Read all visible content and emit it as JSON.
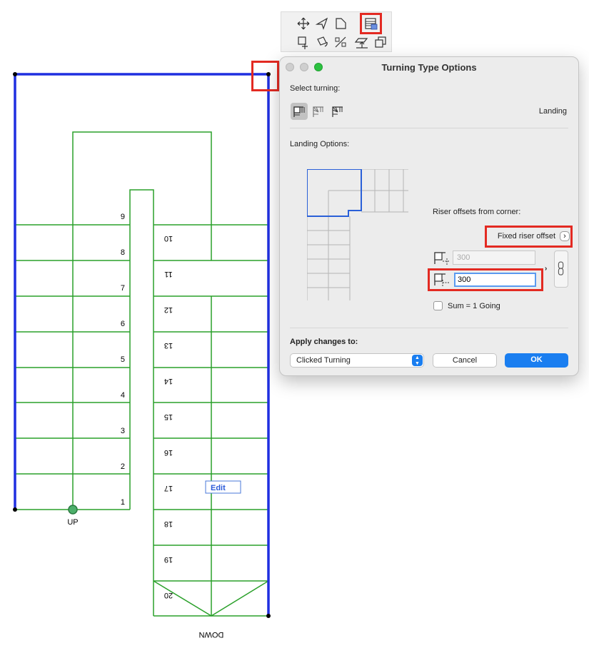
{
  "plan": {
    "step_numbers_up": [
      "9",
      "8",
      "7",
      "6",
      "5",
      "4",
      "3",
      "2",
      "1"
    ],
    "step_numbers_down": [
      "10",
      "11",
      "12",
      "13",
      "14",
      "15",
      "16",
      "17",
      "18",
      "19",
      "20"
    ],
    "label_up": "UP",
    "label_down": "DOWN",
    "edit_label": "Edit",
    "colors": {
      "boundary": "#1f2fe0",
      "stair_lines": "#2aa02a",
      "highlight": "#e32a22"
    }
  },
  "toolbar": {
    "row1": [
      "move-icon",
      "drag-vertex-icon",
      "corner-icon",
      "turning-options-icon"
    ],
    "row2": [
      "offset-icon",
      "rotate-icon",
      "mirror-icon",
      "elevate-icon",
      "multiply-icon"
    ]
  },
  "dialog": {
    "title": "Turning Type Options",
    "select_turning_label": "Select turning:",
    "turning_mode_value": "Landing",
    "landing_options_label": "Landing Options:",
    "riser_offsets_label": "Riser offsets from corner:",
    "fixed_riser_offset_label": "Fixed riser offset",
    "offset1_value": "300",
    "offset2_value": "300",
    "sum_checkbox_label": "Sum = 1 Going",
    "apply_changes_label": "Apply changes to:",
    "apply_select_value": "Clicked Turning",
    "cancel_label": "Cancel",
    "ok_label": "OK",
    "accent_color": "#1a7ef0"
  }
}
